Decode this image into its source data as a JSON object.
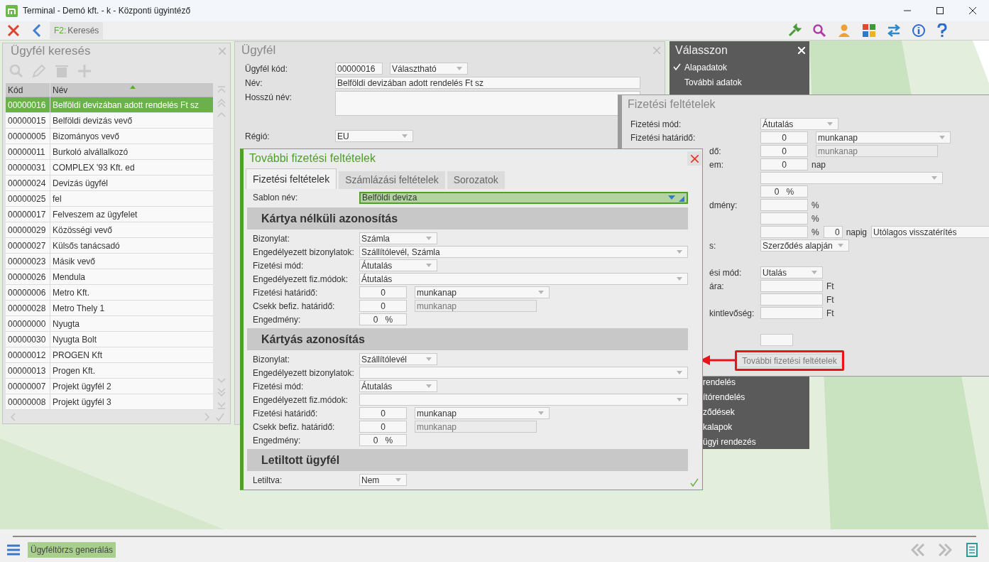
{
  "window": {
    "title": "Terminal - Demó kft. - k - Központi ügyintéző"
  },
  "toolbar": {
    "tab": {
      "key": "F2:",
      "label": "Keresés"
    }
  },
  "search_panel": {
    "title": "Ügyfél keresés",
    "columns": [
      "Kód",
      "Név"
    ],
    "rows": [
      {
        "code": "00000016",
        "name": "Belföldi devizában adott rendelés Ft sz",
        "selected": true
      },
      {
        "code": "00000015",
        "name": "Belföldi devizás vevő",
        "selected": false
      },
      {
        "code": "00000005",
        "name": "Bizományos vevő",
        "selected": false
      },
      {
        "code": "00000011",
        "name": "Burkoló alvállalkozó",
        "selected": false
      },
      {
        "code": "00000031",
        "name": "COMPLEX '93 Kft.  ed",
        "selected": false
      },
      {
        "code": "00000024",
        "name": "Devizás ügyfél",
        "selected": false
      },
      {
        "code": "00000025",
        "name": "fel",
        "selected": false
      },
      {
        "code": "00000017",
        "name": "Felveszem az ügyfelet",
        "selected": false
      },
      {
        "code": "00000029",
        "name": "Közösségi vevő",
        "selected": false
      },
      {
        "code": "00000027",
        "name": "Külsős tanácsadó",
        "selected": false
      },
      {
        "code": "00000023",
        "name": "Másik vevő",
        "selected": false
      },
      {
        "code": "00000026",
        "name": "Mendula",
        "selected": false
      },
      {
        "code": "00000006",
        "name": "Metro Kft.",
        "selected": false
      },
      {
        "code": "00000028",
        "name": "Metro Thely 1",
        "selected": false
      },
      {
        "code": "00000000",
        "name": "Nyugta",
        "selected": false
      },
      {
        "code": "00000030",
        "name": "Nyugta Bolt",
        "selected": false
      },
      {
        "code": "00000012",
        "name": "PROGEN Kft",
        "selected": false
      },
      {
        "code": "00000013",
        "name": "Progen Kft.",
        "selected": false
      },
      {
        "code": "00000007",
        "name": "Projekt  ügyfél 2",
        "selected": false
      },
      {
        "code": "00000008",
        "name": "Projekt  ügyfél 3",
        "selected": false
      }
    ]
  },
  "customer_panel": {
    "title": "Ügyfél",
    "rows": [
      {
        "label": "Ügyfél kód:",
        "items": [
          {
            "kind": "code",
            "value": "00000016"
          },
          {
            "kind": "dropdown",
            "value": "Választható"
          }
        ]
      },
      {
        "label": "Név:",
        "items": [
          {
            "kind": "wide_text",
            "value": "Belföldi devizában adott rendelés Ft sz"
          }
        ]
      },
      {
        "label": "Hosszú név:",
        "items": [
          {
            "kind": "textarea"
          }
        ]
      },
      {
        "label": "Régió:",
        "items": [
          {
            "kind": "dropdown",
            "value": "EU"
          }
        ]
      }
    ]
  },
  "choose_menu": {
    "title": "Válasszon",
    "items": [
      {
        "label": "Alapadatok",
        "checked": true
      },
      {
        "label": "További adatok",
        "checked": false
      }
    ],
    "lower_items": [
      {
        "label_fragment": "rendelés"
      },
      {
        "label_fragment": "ítórendelés"
      },
      {
        "label_fragment": "ződések"
      },
      {
        "label_fragment": "kalapok"
      },
      {
        "label_fragment": "ügyi rendezés"
      }
    ]
  },
  "payment_panel": {
    "title": "Fizetési feltételek",
    "rows": [
      {
        "label": "Fizetési mód:",
        "items": [
          {
            "kind": "dropdown",
            "value": "Átutalás"
          }
        ]
      },
      {
        "label": "Fizetési határidő:",
        "items": [
          {
            "kind": "number",
            "value": "0"
          },
          {
            "kind": "unit_dropdown",
            "value": "munkanap"
          }
        ]
      },
      {
        "label_fragment": "dő:",
        "items": [
          {
            "kind": "number",
            "value": "0"
          },
          {
            "kind": "readonly",
            "value": "munkanap"
          }
        ]
      },
      {
        "label_fragment": "em:",
        "items": [
          {
            "kind": "number",
            "value": "0"
          },
          {
            "kind": "unit",
            "value": "nap"
          }
        ]
      },
      {
        "items": [
          {
            "kind": "long_dropdown"
          }
        ]
      },
      {
        "items": [
          {
            "kind": "percent",
            "value": "0",
            "suffix": "%"
          }
        ]
      },
      {
        "label_fragment": "dmény:",
        "items": [
          {
            "kind": "number"
          },
          {
            "kind": "unit",
            "value": "%"
          }
        ]
      },
      {
        "items": [
          {
            "kind": "number"
          },
          {
            "kind": "unit",
            "value": "%"
          }
        ]
      },
      {
        "items": [
          {
            "kind": "number"
          },
          {
            "kind": "unit",
            "value": "%"
          },
          {
            "kind": "tiny_number",
            "value": "0"
          },
          {
            "kind": "unit",
            "value": "napig"
          },
          {
            "kind": "long_text",
            "value": "Utólagos visszatérítés"
          }
        ]
      },
      {
        "label_fragment": "s:",
        "items": [
          {
            "kind": "dropdown",
            "value": "Szerződés alapján"
          }
        ]
      },
      {
        "items": []
      },
      {
        "label_fragment": "ési mód:",
        "items": [
          {
            "kind": "mid_dropdown",
            "value": "Utalás"
          }
        ]
      },
      {
        "label_fragment": "ára:",
        "items": [
          {
            "kind": "amount"
          },
          {
            "kind": "unit",
            "value": "Ft"
          }
        ]
      },
      {
        "items": [
          {
            "kind": "amount"
          },
          {
            "kind": "unit",
            "value": "Ft"
          }
        ]
      },
      {
        "label_fragment": "kintlevőség:",
        "items": [
          {
            "kind": "amount"
          },
          {
            "kind": "unit",
            "value": "Ft"
          }
        ]
      },
      {
        "items": []
      },
      {
        "items": [
          {
            "kind": "small_number"
          }
        ]
      }
    ],
    "button": "További fizetési feltételek"
  },
  "dialog": {
    "title": "További fizetési feltételek",
    "tabs": [
      {
        "label": "Fizetési feltételek",
        "selected": true
      },
      {
        "label": "Számlázási feltételek",
        "selected": false
      },
      {
        "label": "Sorozatok",
        "selected": false
      }
    ],
    "template": {
      "label": "Sablon név:",
      "value": "Belföldi deviza"
    },
    "sections": [
      {
        "title": "Kártya nélküli azonosítás",
        "rows": [
          {
            "label": "Bizonylat:",
            "items": [
              {
                "kind": "dropdown",
                "value": "Számla"
              }
            ]
          },
          {
            "label": "Engedélyezett bizonylatok:",
            "items": [
              {
                "kind": "wide_dropdown",
                "value": "Szállítólevél, Számla"
              }
            ]
          },
          {
            "label": "Fizetési mód:",
            "items": [
              {
                "kind": "dropdown",
                "value": "Átutalás"
              }
            ]
          },
          {
            "label": "Engedélyezett fiz.módok:",
            "items": [
              {
                "kind": "wide_dropdown",
                "value": "Átutalás"
              }
            ]
          },
          {
            "label": "Fizetési határidő:",
            "items": [
              {
                "kind": "number",
                "value": "0"
              },
              {
                "kind": "unit_dropdown",
                "value": "munkanap"
              }
            ]
          },
          {
            "label": "Csekk befiz. határidő:",
            "items": [
              {
                "kind": "number",
                "value": "0"
              },
              {
                "kind": "readonly",
                "value": "munkanap"
              }
            ]
          },
          {
            "label": "Engedmény:",
            "items": [
              {
                "kind": "percent",
                "value": "0",
                "suffix": "%"
              }
            ]
          }
        ]
      },
      {
        "title": "Kártyás azonosítás",
        "rows": [
          {
            "label": "Bizonylat:",
            "items": [
              {
                "kind": "dropdown",
                "value": "Szállítólevél"
              }
            ]
          },
          {
            "label": "Engedélyezett bizonylatok:",
            "items": [
              {
                "kind": "wide_dropdown"
              }
            ]
          },
          {
            "label": "Fizetési mód:",
            "items": [
              {
                "kind": "dropdown",
                "value": "Átutalás"
              }
            ]
          },
          {
            "label": "Engedélyezett fiz.módok:",
            "items": [
              {
                "kind": "wide_dropdown"
              }
            ]
          },
          {
            "label": "Fizetési határidő:",
            "items": [
              {
                "kind": "number",
                "value": "0"
              },
              {
                "kind": "unit_dropdown",
                "value": "munkanap"
              }
            ]
          },
          {
            "label": "Csekk befiz. határidő:",
            "items": [
              {
                "kind": "number",
                "value": "0"
              },
              {
                "kind": "readonly",
                "value": "munkanap"
              }
            ]
          },
          {
            "label": "Engedmény:",
            "items": [
              {
                "kind": "percent",
                "value": "0",
                "suffix": "%"
              }
            ]
          }
        ]
      },
      {
        "title": "Letiltott ügyfél",
        "rows": [
          {
            "label": "Letiltva:",
            "items": [
              {
                "kind": "small_dropdown",
                "value": "Nem"
              }
            ]
          }
        ]
      }
    ]
  },
  "bottom_bar": {
    "button": "Ügyféltörzs generálás"
  }
}
